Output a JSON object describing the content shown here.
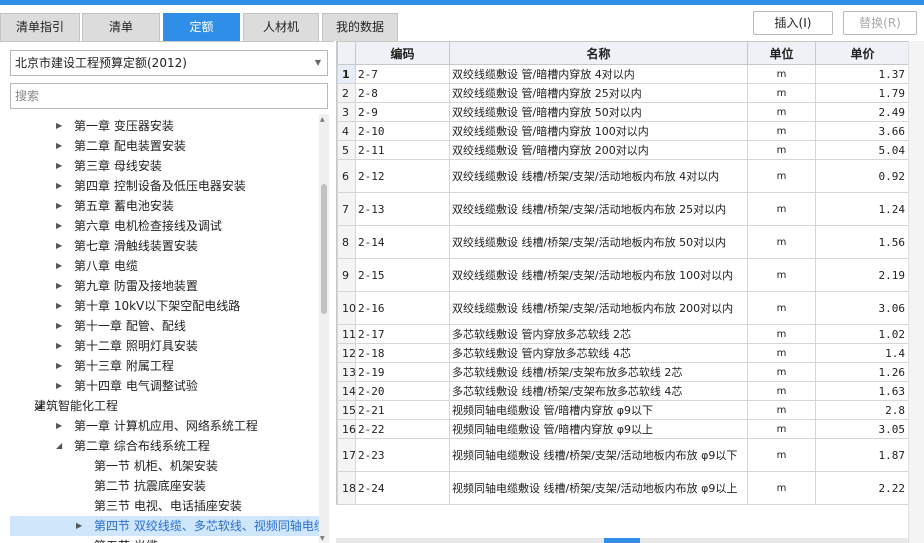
{
  "tabs": [
    {
      "label": "清单指引",
      "active": false
    },
    {
      "label": "清单",
      "active": false
    },
    {
      "label": "定额",
      "active": true
    },
    {
      "label": "人材机",
      "active": false
    },
    {
      "label": "我的数据",
      "active": false
    }
  ],
  "left": {
    "quota_select": "北京市建设工程预算定额(2012)",
    "search_placeholder": "搜索",
    "tree": [
      {
        "label": "第一章 变压器安装",
        "level": 1,
        "expanded": false
      },
      {
        "label": "第二章 配电装置安装",
        "level": 1,
        "expanded": false
      },
      {
        "label": "第三章 母线安装",
        "level": 1,
        "expanded": false
      },
      {
        "label": "第四章 控制设备及低压电器安装",
        "level": 1,
        "expanded": false
      },
      {
        "label": "第五章 蓄电池安装",
        "level": 1,
        "expanded": false
      },
      {
        "label": "第六章 电机检查接线及调试",
        "level": 1,
        "expanded": false
      },
      {
        "label": "第七章 滑触线装置安装",
        "level": 1,
        "expanded": false
      },
      {
        "label": "第八章 电缆",
        "level": 1,
        "expanded": false
      },
      {
        "label": "第九章 防雷及接地装置",
        "level": 1,
        "expanded": false
      },
      {
        "label": "第十章 10kV以下架空配电线路",
        "level": 1,
        "expanded": false
      },
      {
        "label": "第十一章 配管、配线",
        "level": 1,
        "expanded": false
      },
      {
        "label": "第十二章 照明灯具安装",
        "level": 1,
        "expanded": false
      },
      {
        "label": "第十三章 附属工程",
        "level": 1,
        "expanded": false
      },
      {
        "label": "第十四章 电气调整试验",
        "level": 1,
        "expanded": false
      },
      {
        "label": "建筑智能化工程",
        "level": 0,
        "expanded": true
      },
      {
        "label": "第一章 计算机应用、网络系统工程",
        "level": 1,
        "expanded": false
      },
      {
        "label": "第二章 综合布线系统工程",
        "level": 1,
        "expanded": true
      },
      {
        "label": "第一节 机柜、机架安装",
        "level": 2,
        "expanded": null
      },
      {
        "label": "第二节 抗震底座安装",
        "level": 2,
        "expanded": null
      },
      {
        "label": "第三节 电视、电话插座安装",
        "level": 2,
        "expanded": null
      },
      {
        "label": "第四节 双绞线缆、多芯软线、视频同轴电缆",
        "level": 2,
        "expanded": false,
        "selected": true
      },
      {
        "label": "第五节 光缆",
        "level": 2,
        "expanded": false
      }
    ]
  },
  "toolbar": {
    "insert": "插入(I)",
    "replace": "替换(R)"
  },
  "grid": {
    "headers": [
      "",
      "编码",
      "名称",
      "单位",
      "单价"
    ],
    "rows": [
      {
        "idx": "1",
        "code": "2-7",
        "name": "双绞线缆敷设 管/暗槽内穿放 4对以内",
        "unit": "m",
        "price": "1.37",
        "tall": false
      },
      {
        "idx": "2",
        "code": "2-8",
        "name": "双绞线缆敷设 管/暗槽内穿放 25对以内",
        "unit": "m",
        "price": "1.79",
        "tall": false
      },
      {
        "idx": "3",
        "code": "2-9",
        "name": "双绞线缆敷设 管/暗槽内穿放 50对以内",
        "unit": "m",
        "price": "2.49",
        "tall": false
      },
      {
        "idx": "4",
        "code": "2-10",
        "name": "双绞线缆敷设 管/暗槽内穿放 100对以内",
        "unit": "m",
        "price": "3.66",
        "tall": false
      },
      {
        "idx": "5",
        "code": "2-11",
        "name": "双绞线缆敷设 管/暗槽内穿放 200对以内",
        "unit": "m",
        "price": "5.04",
        "tall": false
      },
      {
        "idx": "6",
        "code": "2-12",
        "name": "双绞线缆敷设 线槽/桥架/支架/活动地板内布放 4对以内",
        "unit": "m",
        "price": "0.92",
        "tall": true
      },
      {
        "idx": "7",
        "code": "2-13",
        "name": "双绞线缆敷设 线槽/桥架/支架/活动地板内布放 25对以内",
        "unit": "m",
        "price": "1.24",
        "tall": true
      },
      {
        "idx": "8",
        "code": "2-14",
        "name": "双绞线缆敷设 线槽/桥架/支架/活动地板内布放 50对以内",
        "unit": "m",
        "price": "1.56",
        "tall": true
      },
      {
        "idx": "9",
        "code": "2-15",
        "name": "双绞线缆敷设 线槽/桥架/支架/活动地板内布放 100对以内",
        "unit": "m",
        "price": "2.19",
        "tall": true
      },
      {
        "idx": "10",
        "code": "2-16",
        "name": "双绞线缆敷设 线槽/桥架/支架/活动地板内布放 200对以内",
        "unit": "m",
        "price": "3.06",
        "tall": true
      },
      {
        "idx": "11",
        "code": "2-17",
        "name": "多芯软线敷设 管内穿放多芯软线 2芯",
        "unit": "m",
        "price": "1.02",
        "tall": false
      },
      {
        "idx": "12",
        "code": "2-18",
        "name": "多芯软线敷设 管内穿放多芯软线 4芯",
        "unit": "m",
        "price": "1.4",
        "tall": false
      },
      {
        "idx": "13",
        "code": "2-19",
        "name": "多芯软线敷设 线槽/桥架/支架布放多芯软线 2芯",
        "unit": "m",
        "price": "1.26",
        "tall": false
      },
      {
        "idx": "14",
        "code": "2-20",
        "name": "多芯软线敷设 线槽/桥架/支架布放多芯软线 4芯",
        "unit": "m",
        "price": "1.63",
        "tall": false
      },
      {
        "idx": "15",
        "code": "2-21",
        "name": "视频同轴电缆敷设 管/暗槽内穿放 φ9以下",
        "unit": "m",
        "price": "2.8",
        "tall": false
      },
      {
        "idx": "16",
        "code": "2-22",
        "name": "视频同轴电缆敷设 管/暗槽内穿放 φ9以上",
        "unit": "m",
        "price": "3.05",
        "tall": false
      },
      {
        "idx": "17",
        "code": "2-23",
        "name": "视频同轴电缆敷设 线槽/桥架/支架/活动地板内布放 φ9以下",
        "unit": "m",
        "price": "1.87",
        "tall": true
      },
      {
        "idx": "18",
        "code": "2-24",
        "name": "视频同轴电缆敷设 线槽/桥架/支架/活动地板内布放 φ9以上",
        "unit": "m",
        "price": "2.22",
        "tall": true
      }
    ]
  }
}
